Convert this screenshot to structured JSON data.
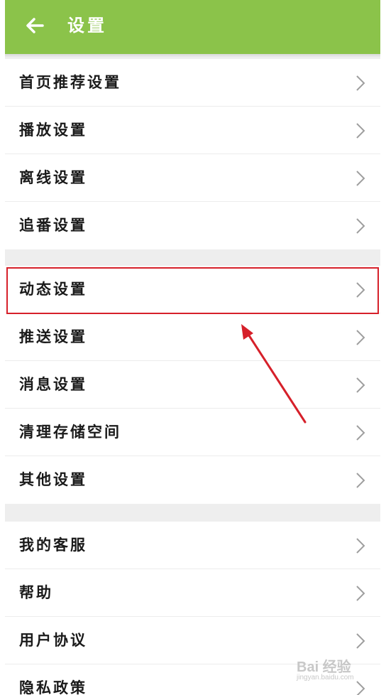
{
  "header": {
    "title": "设置",
    "back_icon": "arrow-left-icon",
    "background": "#8bc34a"
  },
  "groups": [
    {
      "items": [
        {
          "label": "首页推荐设置"
        },
        {
          "label": "播放设置"
        },
        {
          "label": "离线设置"
        },
        {
          "label": "追番设置"
        }
      ]
    },
    {
      "items": [
        {
          "label": "动态设置"
        },
        {
          "label": "推送设置"
        },
        {
          "label": "消息设置"
        },
        {
          "label": "清理存储空间"
        },
        {
          "label": "其他设置"
        }
      ]
    },
    {
      "items": [
        {
          "label": "我的客服"
        },
        {
          "label": "帮助"
        },
        {
          "label": "用户协议"
        },
        {
          "label": "隐私政策"
        }
      ]
    }
  ],
  "annotation": {
    "highlighted_item": "动态设置",
    "color": "#d6202a"
  },
  "watermark": {
    "main": "Bai 经验",
    "sub": "jingyan.baidu.com"
  }
}
